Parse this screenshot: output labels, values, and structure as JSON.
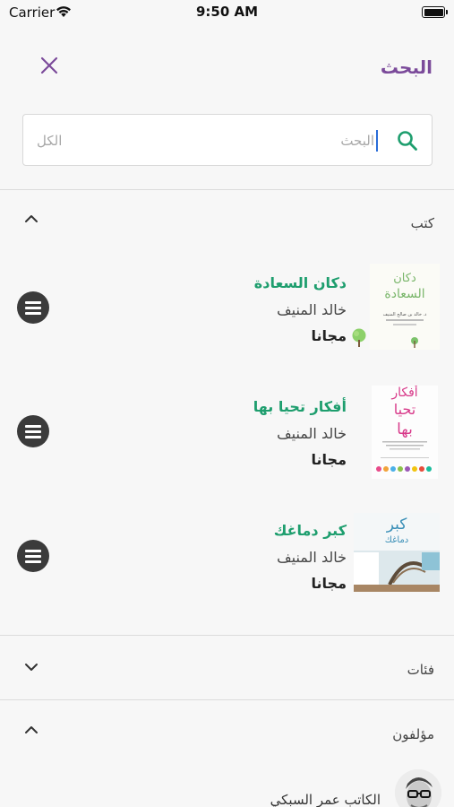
{
  "status_bar": {
    "carrier": "Carrier",
    "time": "9:50 AM"
  },
  "header": {
    "title": "البحث"
  },
  "search": {
    "placeholder": "البحث",
    "scope": "الكل"
  },
  "sections": {
    "books": {
      "title": "كتب",
      "expanded": true
    },
    "categories": {
      "title": "فئات",
      "expanded": false
    },
    "authors": {
      "title": "مؤلفون",
      "expanded": true
    }
  },
  "books": [
    {
      "title": "دكان السعادة",
      "author": "خالد المنيف",
      "price": "مجانا",
      "cover": {
        "line1": "دكان",
        "line2": "السعادة",
        "byline": "د. خالد بن صالح المنيف"
      }
    },
    {
      "title": "أفكار تحيا بها",
      "author": "خالد المنيف",
      "price": "مجانا",
      "cover": {
        "line1": "أفكار",
        "line2": "تحيا",
        "line3": "بها"
      }
    },
    {
      "title": "كبر دماغك",
      "author": "خالد المنيف",
      "price": "مجانا",
      "cover": {
        "line1": "كبر",
        "line2": "دماغك"
      }
    }
  ],
  "authors": [
    {
      "name": "الكاتب عمر السبكي"
    }
  ],
  "colors": {
    "accent": "#7b4a9a",
    "book_title": "#1e9e6e",
    "search_icon": "#1e9e6e"
  }
}
